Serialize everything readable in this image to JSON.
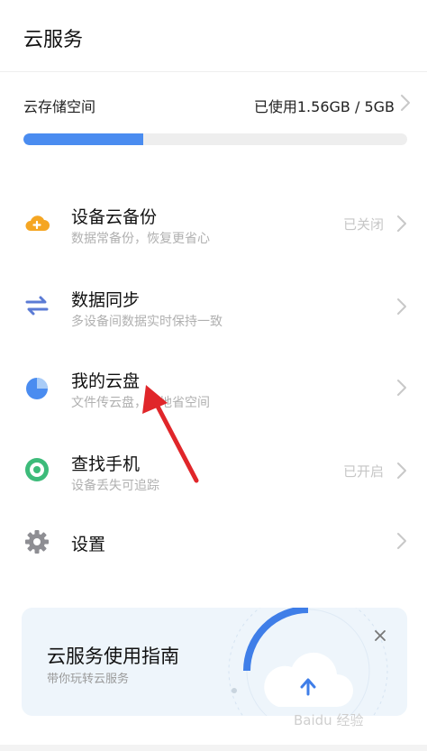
{
  "header": {
    "title": "云服务"
  },
  "storage": {
    "label": "云存储空间",
    "usage_text": "已使用1.56GB / 5GB",
    "used_fraction": 0.312
  },
  "items": [
    {
      "name": "设备云备份",
      "desc": "数据常备份，恢复更省心",
      "status": "已关闭",
      "icon": "cloud-backup-icon"
    },
    {
      "name": "数据同步",
      "desc": "多设备间数据实时保持一致",
      "status": "",
      "icon": "sync-arrows-icon"
    },
    {
      "name": "我的云盘",
      "desc": "文件传云盘，本地省空间",
      "status": "",
      "icon": "cloud-drive-icon"
    },
    {
      "name": "查找手机",
      "desc": "设备丢失可追踪",
      "status": "已开启",
      "icon": "find-phone-icon"
    },
    {
      "name": "设置",
      "desc": "",
      "status": "",
      "icon": "gear-icon"
    }
  ],
  "banner": {
    "title": "云服务使用指南",
    "subtitle": "带你玩转云服务"
  },
  "watermark": {
    "text": "Baidu 经验"
  },
  "colors": {
    "accent": "#4a8cf0",
    "orange": "#f5a623",
    "green": "#3dbb7a",
    "gray_icon": "#8e8e93"
  }
}
